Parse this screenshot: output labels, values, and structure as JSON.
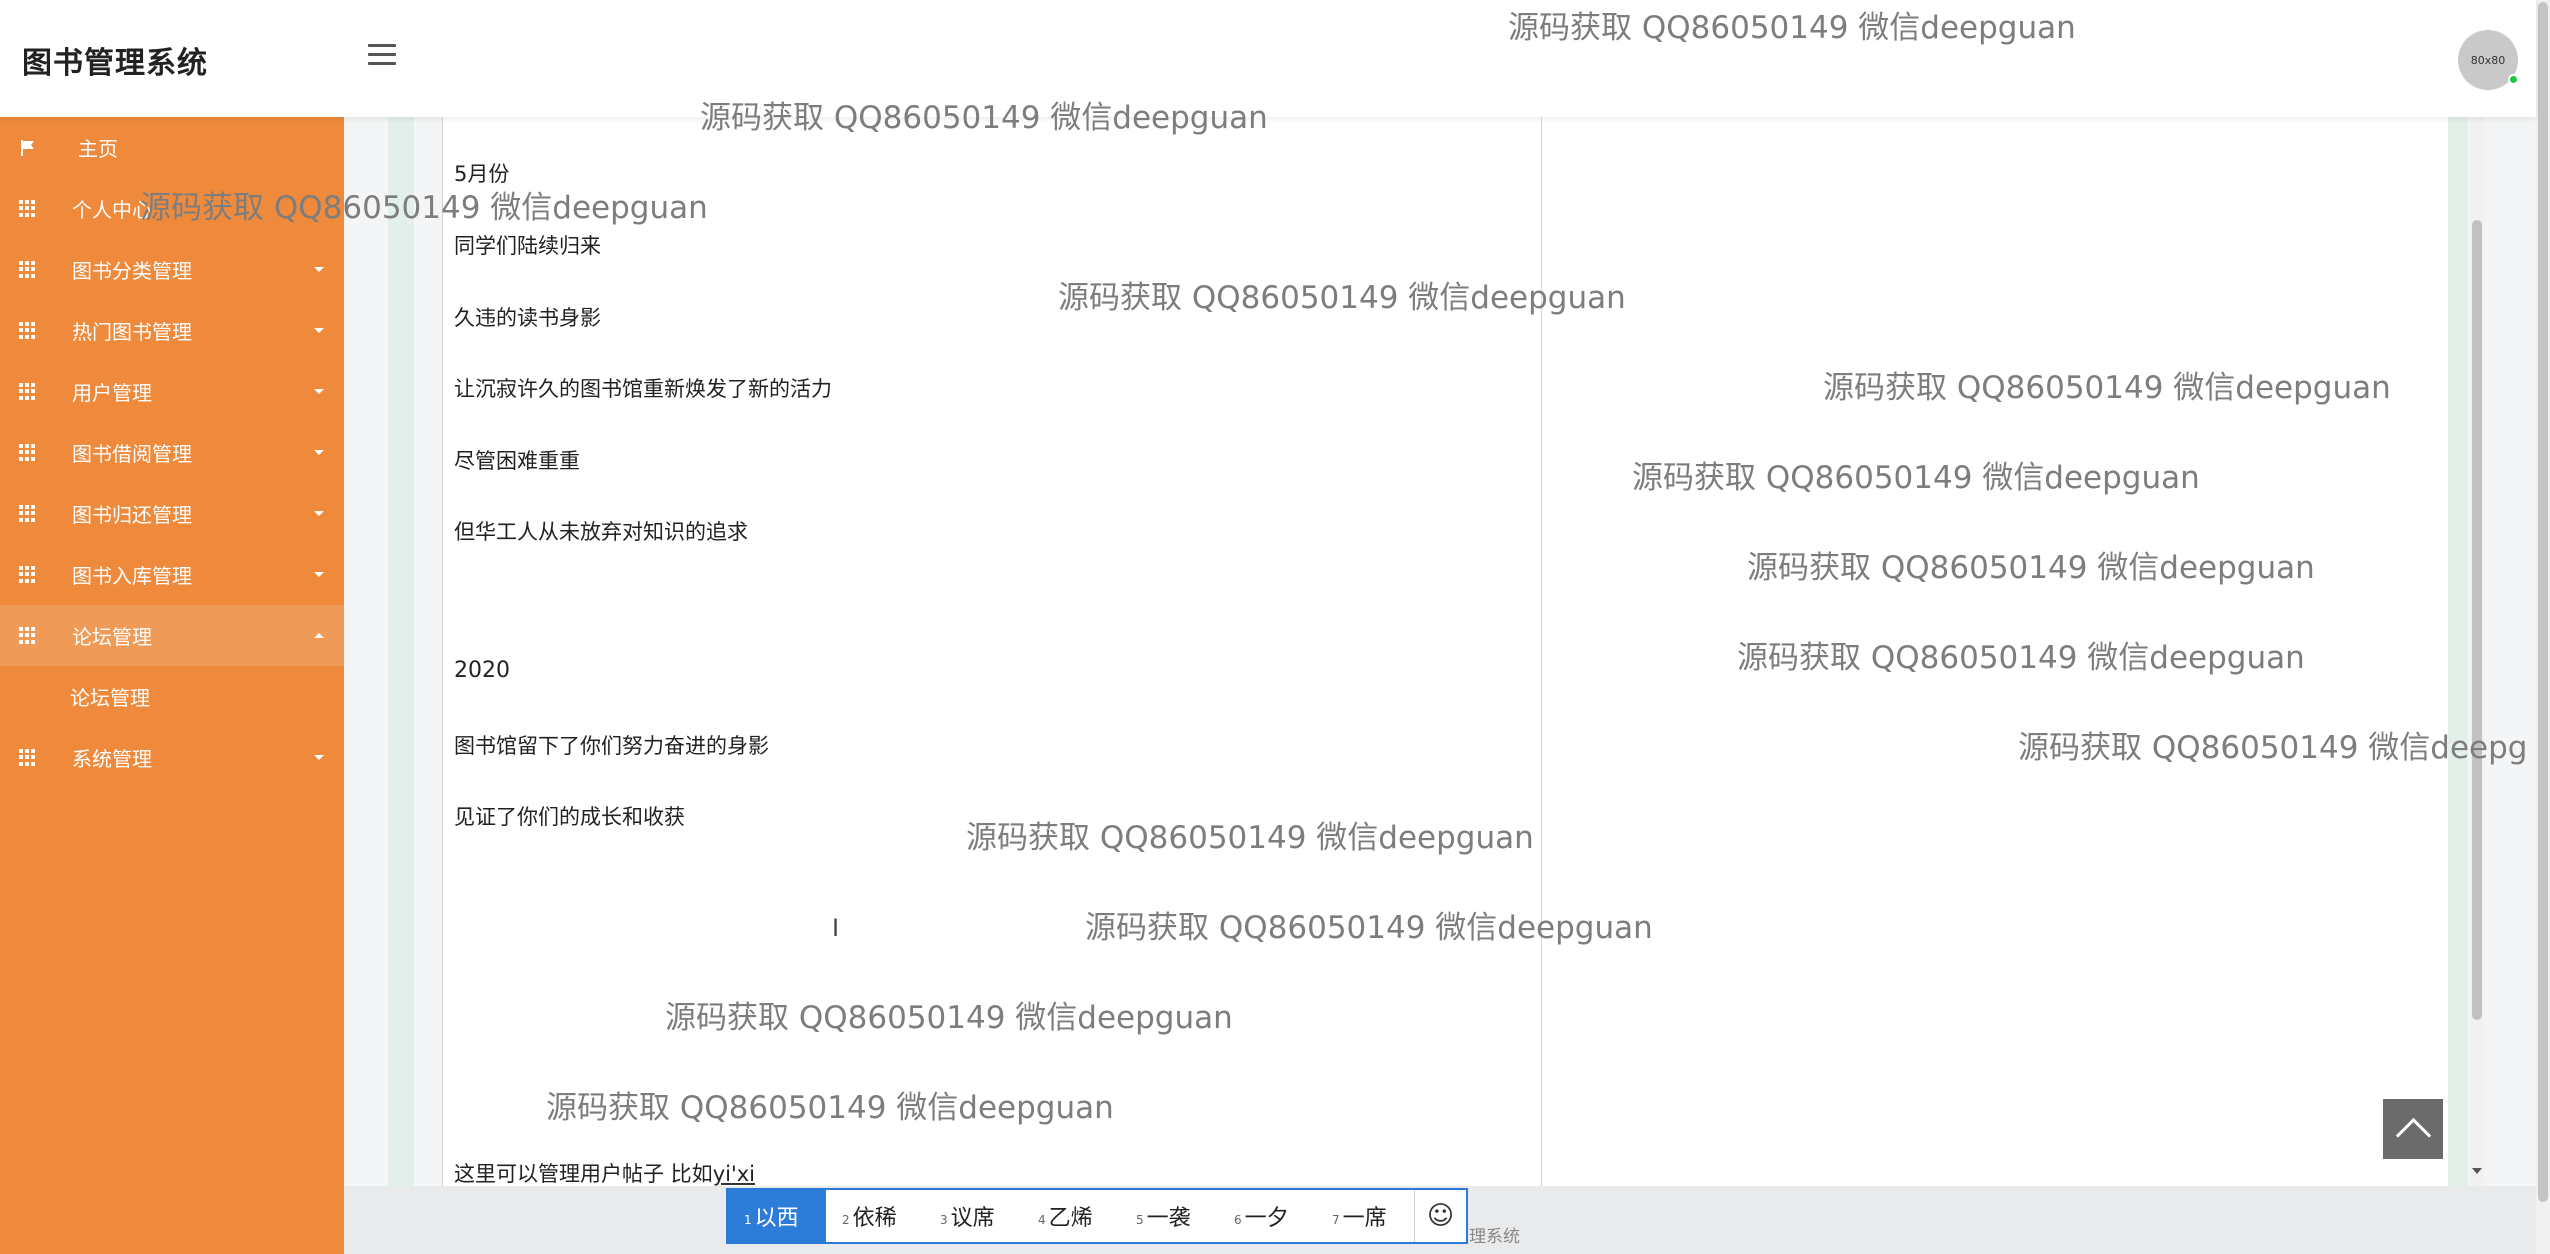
{
  "header": {
    "brand": "图书管理系统",
    "avatar_text": "80x80"
  },
  "sidebar": {
    "items": [
      {
        "label": "主页",
        "icon": "flag-icon"
      },
      {
        "label": "个人中心",
        "icon": "grid-icon"
      },
      {
        "label": "图书分类管理",
        "icon": "grid-icon"
      },
      {
        "label": "热门图书管理",
        "icon": "grid-icon"
      },
      {
        "label": "用户管理",
        "icon": "grid-icon"
      },
      {
        "label": "图书借阅管理",
        "icon": "grid-icon"
      },
      {
        "label": "图书归还管理",
        "icon": "grid-icon"
      },
      {
        "label": "图书入库管理",
        "icon": "grid-icon"
      },
      {
        "label": "论坛管理",
        "icon": "grid-icon"
      },
      {
        "label": "系统管理",
        "icon": "grid-icon"
      }
    ],
    "sub_item": "论坛管理"
  },
  "editor": {
    "lines": [
      "5月份",
      "同学们陆续归来",
      "久违的读书身影",
      "让沉寂许久的图书馆重新焕发了新的活力",
      "尽管困难重重",
      "但华工人从未放弃对知识的追求",
      "2020",
      "图书馆留下了你们努力奋进的身影",
      "见证了你们的成长和收获"
    ],
    "last_line_prefix": "这里可以管理用户帖子  比如",
    "last_line_composing": "yi'xi"
  },
  "ime": {
    "candidates": [
      {
        "num": "1",
        "text": "以西"
      },
      {
        "num": "2",
        "text": "依稀"
      },
      {
        "num": "3",
        "text": "议席"
      },
      {
        "num": "4",
        "text": "乙烯"
      },
      {
        "num": "5",
        "text": "一袭"
      },
      {
        "num": "6",
        "text": "一夕"
      },
      {
        "num": "7",
        "text": "一席"
      }
    ],
    "emoji": "☺"
  },
  "footer_fragment": "管理系统",
  "watermark_text": "源码获取 QQ86050149 微信deepguan",
  "colors": {
    "sidebar": "#ef8a3c",
    "sidebar_active": "#f09a57",
    "ime_selected": "#2d7dd8"
  }
}
